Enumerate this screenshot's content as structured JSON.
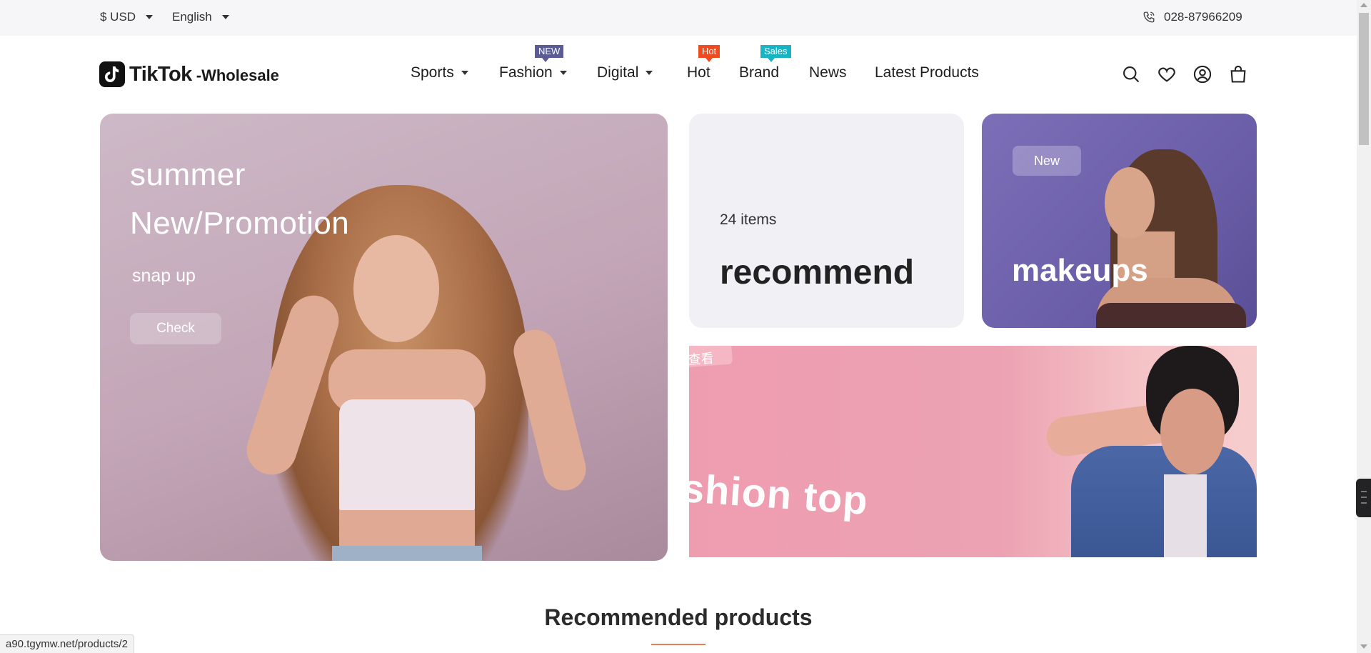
{
  "topbar": {
    "currency": "$ USD",
    "language": "English",
    "phone": "028-87966209"
  },
  "header": {
    "logo_name": "TikTok",
    "logo_sub": "-Wholesale",
    "nav": [
      {
        "label": "Sports",
        "has_dropdown": true
      },
      {
        "label": "Fashion",
        "has_dropdown": true,
        "badge": "NEW"
      },
      {
        "label": "Digital",
        "has_dropdown": true
      },
      {
        "label": "Hot",
        "badge": "Hot"
      },
      {
        "label": "Brand",
        "badge": "Sales"
      },
      {
        "label": "News"
      },
      {
        "label": "Latest Products"
      }
    ],
    "icons": [
      "search-icon",
      "heart-icon",
      "user-icon",
      "bag-icon"
    ]
  },
  "banners": {
    "main": {
      "title_line1": "summer",
      "title_line2": "New/Promotion",
      "subtitle": "snap up",
      "button": "Check"
    },
    "recommend": {
      "count": "24 items",
      "title": "recommend"
    },
    "makeups": {
      "tag": "New",
      "title": "makeups"
    },
    "fashion": {
      "chip": "查看",
      "title": "shion top"
    }
  },
  "section": {
    "title": "Recommended products"
  },
  "status_bar": {
    "url": "a90.tgymw.net/products/2"
  },
  "colors": {
    "badge_new": "#5c5b94",
    "badge_hot": "#ef4b23",
    "badge_sales": "#18b4c3",
    "accent_line": "#e77b5a"
  }
}
